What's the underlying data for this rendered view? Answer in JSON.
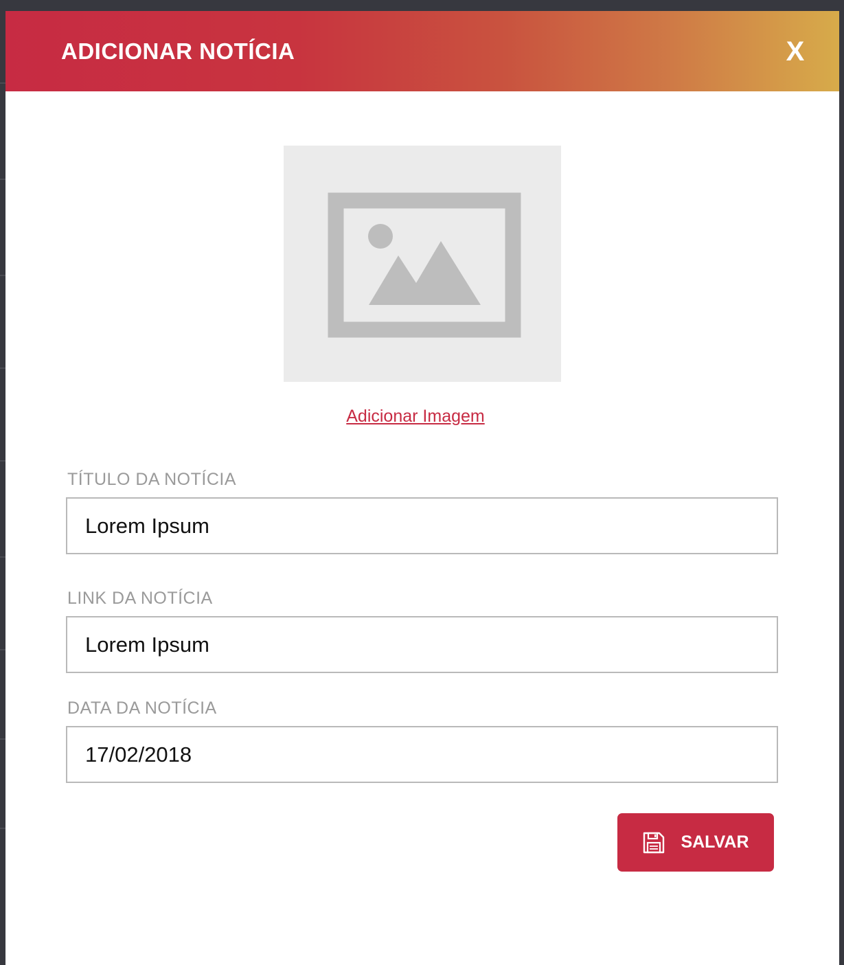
{
  "modal": {
    "title": "ADICIONAR NOTÍCIA",
    "close_label": "X"
  },
  "image": {
    "placeholder_icon": "image-icon",
    "add_link": "Adicionar Imagem"
  },
  "fields": [
    {
      "label": "TÍTULO DA NOTÍCIA",
      "value": "Lorem Ipsum"
    },
    {
      "label": "LINK DA NOTÍCIA",
      "value": "Lorem Ipsum"
    },
    {
      "label": "DATA DA NOTÍCIA",
      "value": "17/02/2018"
    }
  ],
  "actions": {
    "save_label": "SALVAR",
    "save_icon": "floppy-disk-icon"
  },
  "colors": {
    "accent": "#c72b43",
    "header_gradient_start": "#c72b43",
    "header_gradient_end": "#d7ab4a",
    "label_gray": "#9a9a9a",
    "placeholder_bg": "#ebebeb",
    "placeholder_icon": "#bdbdbd"
  }
}
